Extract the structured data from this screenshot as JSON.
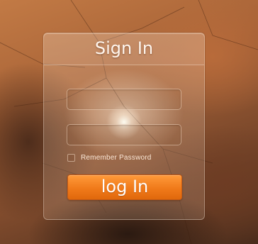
{
  "signin": {
    "title": "Sign In",
    "username_value": "",
    "password_value": "",
    "remember_label": "Remember Password",
    "remember_checked": false,
    "login_label": "log In"
  },
  "colors": {
    "button_orange": "#f07a1a",
    "background_brown": "#a86337",
    "text_light": "#fff6ee"
  }
}
